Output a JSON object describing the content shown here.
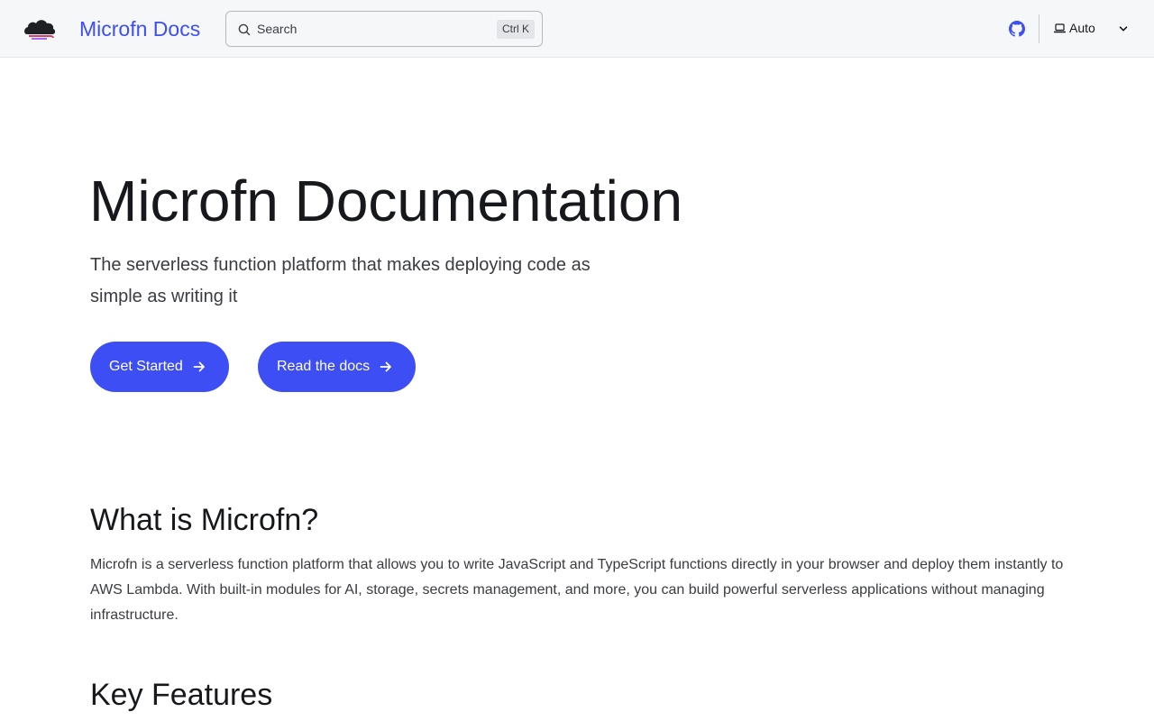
{
  "header": {
    "site_title": "Microfn Docs",
    "search": {
      "label": "Search",
      "shortcut": "Ctrl K"
    },
    "theme": {
      "selected": "Auto"
    }
  },
  "hero": {
    "title": "Microfn Documentation",
    "subtitle": "The serverless function platform that makes deploying code as simple as writing it",
    "buttons": [
      {
        "label": "Get Started"
      },
      {
        "label": "Read the docs"
      }
    ]
  },
  "sections": [
    {
      "heading": "What is Microfn?",
      "body": "Microfn is a serverless function platform that allows you to write JavaScript and TypeScript functions directly in your browser and deploy them instantly to AWS Lambda. With built-in modules for AI, storage, secrets management, and more, you can build powerful serverless applications without managing infrastructure."
    },
    {
      "heading": "Key Features"
    }
  ],
  "colors": {
    "accent": "#3d4ef5",
    "header_bg": "#f6f7f9",
    "text": "#17181c"
  },
  "icons": [
    "cloud-logo-icon",
    "search-icon",
    "github-icon",
    "laptop-icon",
    "chevron-down-icon",
    "arrow-right-icon"
  ]
}
